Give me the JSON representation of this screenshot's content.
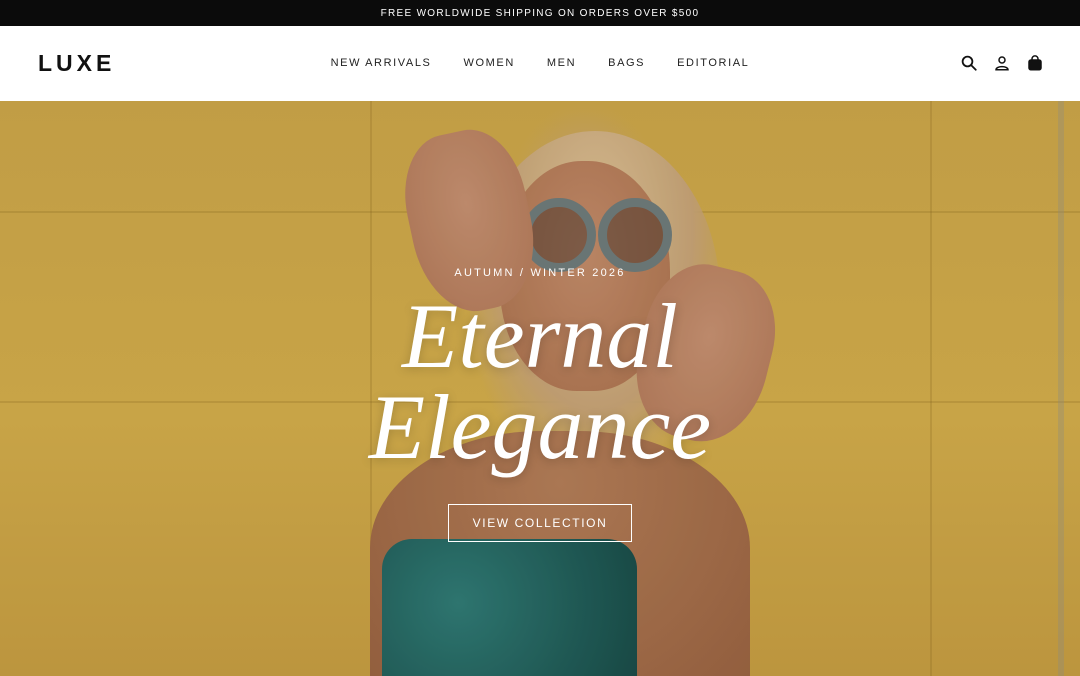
{
  "announcement": {
    "text": "FREE WORLDWIDE SHIPPING ON ORDERS OVER $500"
  },
  "header": {
    "logo": "LUXE",
    "nav": [
      {
        "label": "NEW ARRIVALS"
      },
      {
        "label": "WOMEN"
      },
      {
        "label": "MEN"
      },
      {
        "label": "BAGS"
      },
      {
        "label": "EDITORIAL"
      }
    ],
    "icons": [
      "search-icon",
      "account-icon",
      "shopping-bag-icon"
    ]
  },
  "hero": {
    "eyebrow": "AUTUMN / WINTER 2026",
    "headline_line1": "Eternal",
    "headline_line2": "Elegance",
    "cta_label": "VIEW COLLECTION",
    "background_color": "#d3ad4a"
  },
  "colors": {
    "announcement_bg": "#0b0b0b",
    "text_dark": "#111111",
    "hero_text": "#ffffff"
  }
}
